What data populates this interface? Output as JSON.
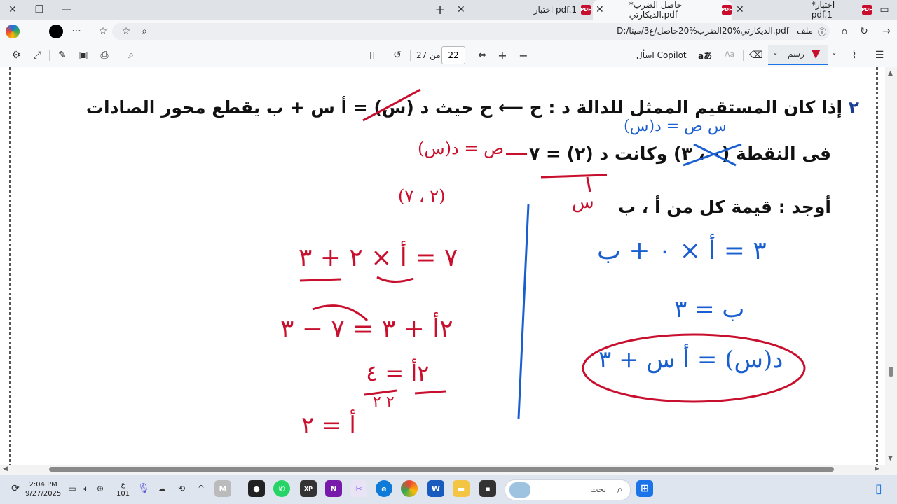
{
  "titlebar": {
    "tabs": [
      {
        "label": "*اختبار pdf.1"
      },
      {
        "label": "*حاصل الضرب الديكارتي.pdf"
      },
      {
        "label": "اختبار pdf.1"
      }
    ],
    "new_tab": "+"
  },
  "addressbar": {
    "url": "D:/الديكارتي%20الضرب%20حاصل/ع3/مينا.pdf",
    "file_label": "ملف",
    "more": "···"
  },
  "pdf_toolbar": {
    "ask_copilot": "اسأل Copilot",
    "draw_label": "رسم",
    "current_page": "22",
    "of_pages": "من 27",
    "minus": "−",
    "plus": "+",
    "aa": "Aa"
  },
  "document": {
    "q_number": "٢",
    "line1": "إذا كان المستقيم الممثل للدالة د : ح ⟵ ح حيث د (س) = أ س + ب يقطع محور الصادات",
    "line2": "فى النقطة (٠ ، ٣) وكانت د (٢) = ٧",
    "line3": "أوجد : قيمة كل من أ ، ب",
    "hw_red_note1": "ص = د(س)",
    "hw_red_note2": "(٢ ، ٧)",
    "hw_blue_note1": "س ص = د(س)",
    "hw_red_s": "س",
    "hw_left1": "٧ = أ × ٢ + ٣",
    "hw_left2": "٢أ + ٣ = ٧ − ٣",
    "hw_left3": "٢أ = ٤",
    "hw_left3b": "٢ ٢",
    "hw_left4": "أ = ٢",
    "hw_right1": "٣ = أ × ٠ + ب",
    "hw_right2": "ب = ٣",
    "hw_right3": "د(س) = أ س + ٣"
  },
  "taskbar": {
    "time": "2:04 PM",
    "date": "9/27/2025",
    "lang": "ع",
    "lang2": "101",
    "search_placeholder": "بحث"
  }
}
